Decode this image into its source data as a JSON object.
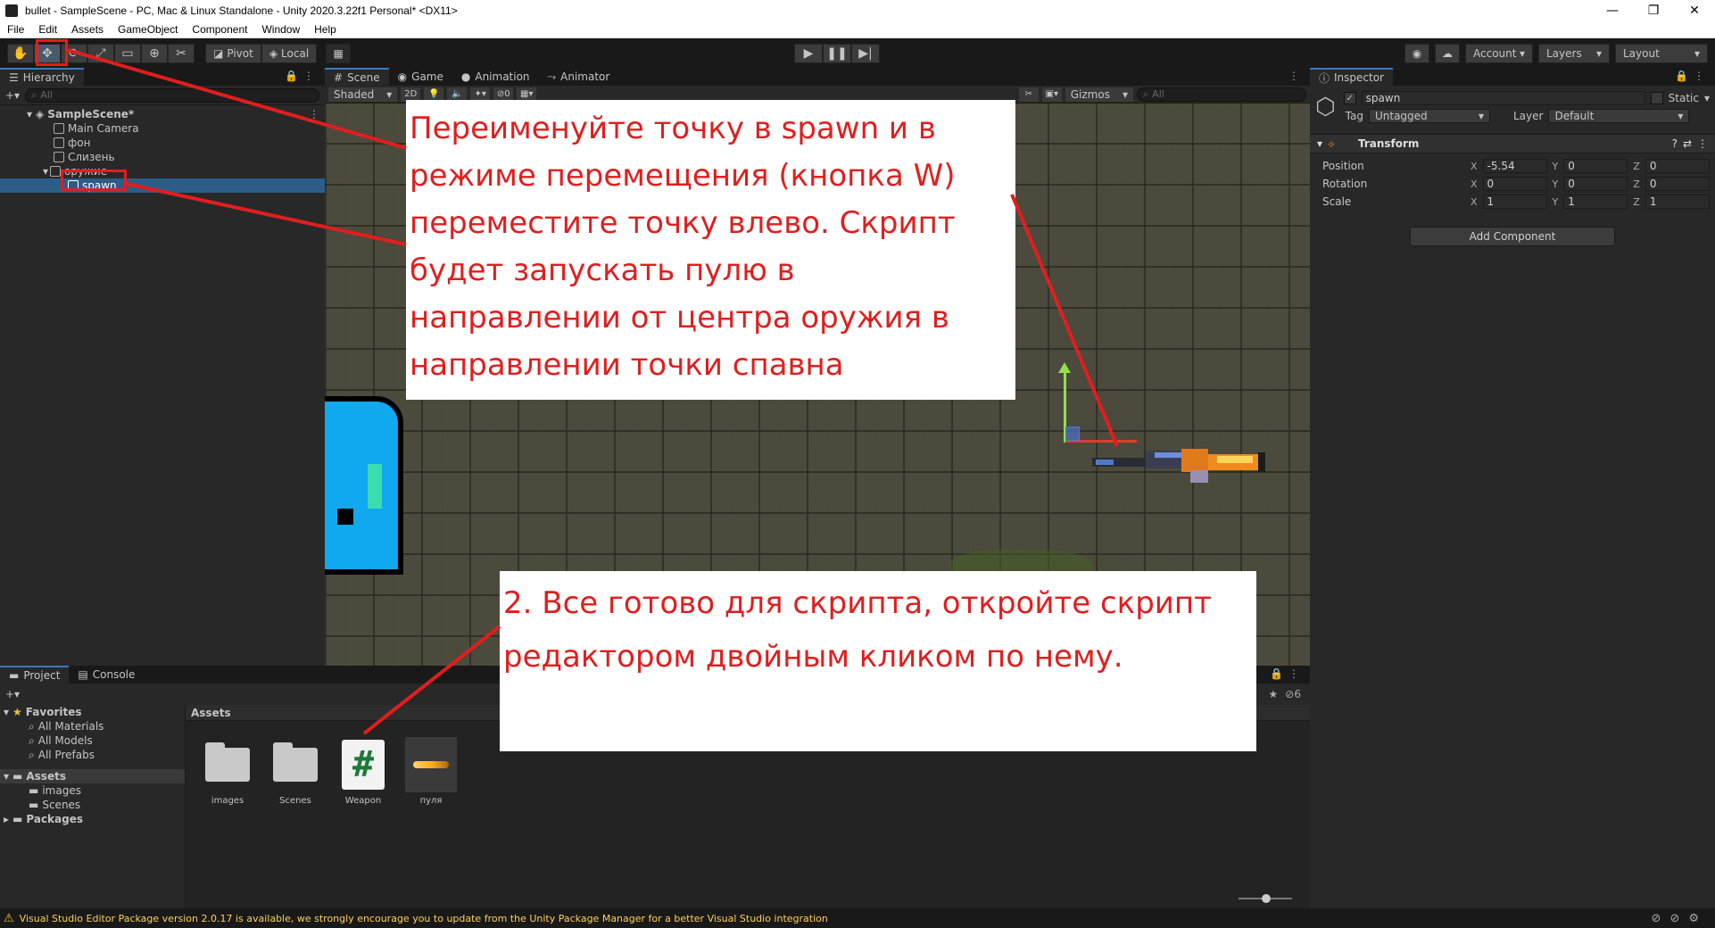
{
  "window": {
    "title": "bullet - SampleScene - PC, Mac & Linux Standalone - Unity 2020.3.22f1 Personal* <DX11>",
    "controls": [
      "—",
      "❐",
      "✕"
    ]
  },
  "menu": [
    "File",
    "Edit",
    "Assets",
    "GameObject",
    "Component",
    "Window",
    "Help"
  ],
  "toolbar": {
    "pivot_label": "Pivot",
    "local_label": "Local",
    "account_label": "Account",
    "layers_label": "Layers",
    "layout_label": "Layout"
  },
  "hierarchy": {
    "tab_label": "Hierarchy",
    "search_placeholder": "All",
    "scene": "SampleScene*",
    "items": [
      {
        "label": "Main Camera"
      },
      {
        "label": "фон"
      },
      {
        "label": "Слизень"
      },
      {
        "label": "оружие"
      }
    ],
    "selected_child": "spawn"
  },
  "scene_view": {
    "tabs": [
      "Scene",
      "Game",
      "Animation",
      "Animator"
    ],
    "shading": "Shaded",
    "mode_2d": "2D",
    "fx_count": "0",
    "gizmos_label": "Gizmos",
    "search_placeholder": "All"
  },
  "annotations": {
    "note1": "Переименуйте точку в spawn и в режиме перемещения (кнопка W) переместите точку влево. Скрипт будет запускать пулю в направлении от центра оружия в направлении точки спавна",
    "note2": "2. Все готово для скрипта, откройте скрипт редактором двойным кликом по нему."
  },
  "inspector": {
    "tab_label": "Inspector",
    "object_name": "spawn",
    "static_label": "Static",
    "tag_label": "Tag",
    "tag_value": "Untagged",
    "layer_label": "Layer",
    "layer_value": "Default",
    "transform_label": "Transform",
    "position_label": "Position",
    "rotation_label": "Rotation",
    "scale_label": "Scale",
    "position": {
      "x": "-5.54",
      "y": "0",
      "z": "0"
    },
    "rotation": {
      "x": "0",
      "y": "0",
      "z": "0"
    },
    "scale": {
      "x": "1",
      "y": "1",
      "z": "1"
    },
    "add_component_label": "Add Component"
  },
  "project": {
    "tabs": [
      "Project",
      "Console"
    ],
    "favorites_label": "Favorites",
    "favorites": [
      "All Materials",
      "All Models",
      "All Prefabs"
    ],
    "assets_label": "Assets",
    "asset_folders": [
      "images",
      "Scenes"
    ],
    "packages_label": "Packages",
    "breadcrumb": "Assets",
    "hidden_count": "6",
    "grid_items": [
      {
        "label": "images",
        "kind": "folder"
      },
      {
        "label": "Scenes",
        "kind": "folder"
      },
      {
        "label": "Weapon",
        "kind": "script"
      },
      {
        "label": "пуля",
        "kind": "sprite"
      }
    ]
  },
  "status": {
    "message": "Visual Studio Editor Package version 2.0.17 is available, we strongly encourage you to update from the Unity Package Manager for a better Visual Studio integration"
  },
  "colors": {
    "annotation_red": "#e01e1e",
    "selection_blue": "#2c5d87",
    "editor_bg": "#282828"
  }
}
